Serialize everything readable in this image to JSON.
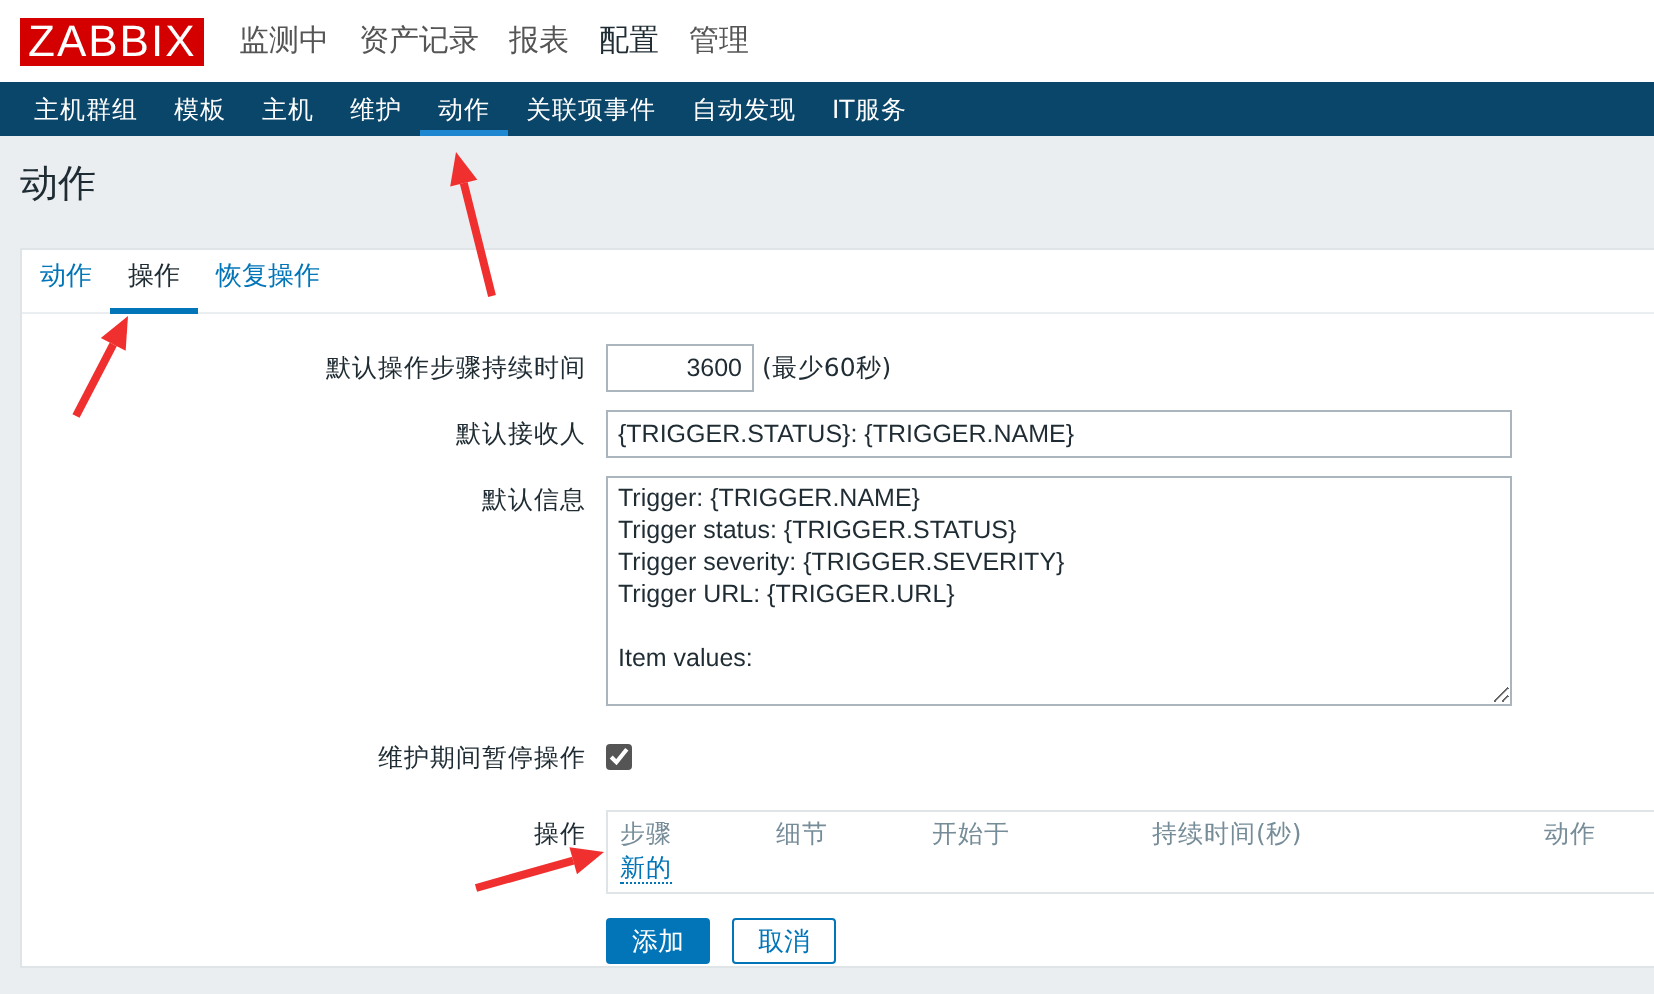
{
  "logo": "ZABBIX",
  "top_menu": [
    {
      "label": "监测中",
      "selected": false
    },
    {
      "label": "资产记录",
      "selected": false
    },
    {
      "label": "报表",
      "selected": false
    },
    {
      "label": "配置",
      "selected": true
    },
    {
      "label": "管理",
      "selected": false
    }
  ],
  "sub_menu": [
    {
      "label": "主机群组",
      "selected": false
    },
    {
      "label": "模板",
      "selected": false
    },
    {
      "label": "主机",
      "selected": false
    },
    {
      "label": "维护",
      "selected": false
    },
    {
      "label": "动作",
      "selected": true
    },
    {
      "label": "关联项事件",
      "selected": false
    },
    {
      "label": "自动发现",
      "selected": false
    },
    {
      "label": "IT服务",
      "selected": false
    }
  ],
  "page_title": "动作",
  "tabs": [
    {
      "label": "动作",
      "selected": false
    },
    {
      "label": "操作",
      "selected": true
    },
    {
      "label": "恢复操作",
      "selected": false
    }
  ],
  "form": {
    "step_duration": {
      "label": "默认操作步骤持续时间",
      "value": "3600",
      "hint": "(最少60秒)"
    },
    "recipient": {
      "label": "默认接收人",
      "value": "{TRIGGER.STATUS}: {TRIGGER.NAME}"
    },
    "message": {
      "label": "默认信息",
      "value": "Trigger: {TRIGGER.NAME}\nTrigger status: {TRIGGER.STATUS}\nTrigger severity: {TRIGGER.SEVERITY}\nTrigger URL: {TRIGGER.URL}\n\nItem values:"
    },
    "pause": {
      "label": "维护期间暂停操作",
      "checked": true
    },
    "operations": {
      "label": "操作",
      "columns": [
        "步骤",
        "细节",
        "开始于",
        "持续时间(秒)",
        "动作"
      ],
      "new_link": "新的"
    }
  },
  "buttons": [
    {
      "label": "添加",
      "kind": "primary"
    },
    {
      "label": "取消",
      "kind": "secondary"
    }
  ]
}
